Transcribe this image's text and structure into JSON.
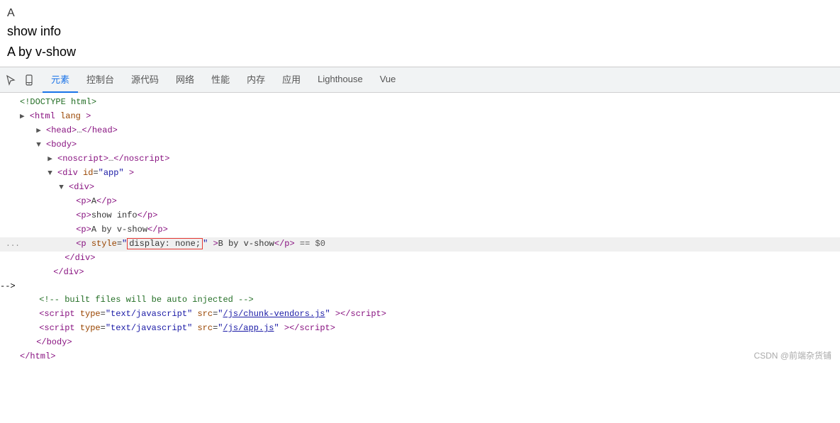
{
  "page": {
    "title_a": "A",
    "show_info": "show info",
    "a_by_vshow": "A by v-show"
  },
  "devtools": {
    "tabs": [
      {
        "id": "elements",
        "label": "元素",
        "active": true
      },
      {
        "id": "console",
        "label": "控制台",
        "active": false
      },
      {
        "id": "sources",
        "label": "源代码",
        "active": false
      },
      {
        "id": "network",
        "label": "网络",
        "active": false
      },
      {
        "id": "performance",
        "label": "性能",
        "active": false
      },
      {
        "id": "memory",
        "label": "内存",
        "active": false
      },
      {
        "id": "application",
        "label": "应用",
        "active": false
      },
      {
        "id": "lighthouse",
        "label": "Lighthouse",
        "active": false
      },
      {
        "id": "vue",
        "label": "Vue",
        "active": false
      }
    ],
    "code_lines": [
      {
        "id": 1,
        "indent": 0,
        "content": "doctype"
      },
      {
        "id": 2,
        "indent": 0,
        "content": "html_lang"
      },
      {
        "id": 3,
        "indent": 0,
        "content": "head_collapsed"
      },
      {
        "id": 4,
        "indent": 0,
        "content": "body_open"
      },
      {
        "id": 5,
        "indent": 1,
        "content": "noscript_collapsed"
      },
      {
        "id": 6,
        "indent": 1,
        "content": "div_app_open"
      },
      {
        "id": 7,
        "indent": 2,
        "content": "div_open"
      },
      {
        "id": 8,
        "indent": 3,
        "content": "p_a"
      },
      {
        "id": 9,
        "indent": 3,
        "content": "p_show_info"
      },
      {
        "id": 10,
        "indent": 3,
        "content": "p_a_by_vshow"
      },
      {
        "id": 11,
        "indent": 3,
        "content": "p_style_b_by_vshow",
        "selected": true
      },
      {
        "id": 12,
        "indent": 2,
        "content": "div_close"
      },
      {
        "id": 13,
        "indent": 1,
        "content": "div_close"
      },
      {
        "id": 14,
        "indent": 0,
        "content": "comment_built"
      },
      {
        "id": 15,
        "indent": 0,
        "content": "script_vendors"
      },
      {
        "id": 16,
        "indent": 0,
        "content": "script_app"
      },
      {
        "id": 17,
        "indent": 0,
        "content": "body_close"
      },
      {
        "id": 18,
        "indent": 0,
        "content": "html_close"
      }
    ]
  },
  "watermark": "CSDN @前端杂货铺"
}
